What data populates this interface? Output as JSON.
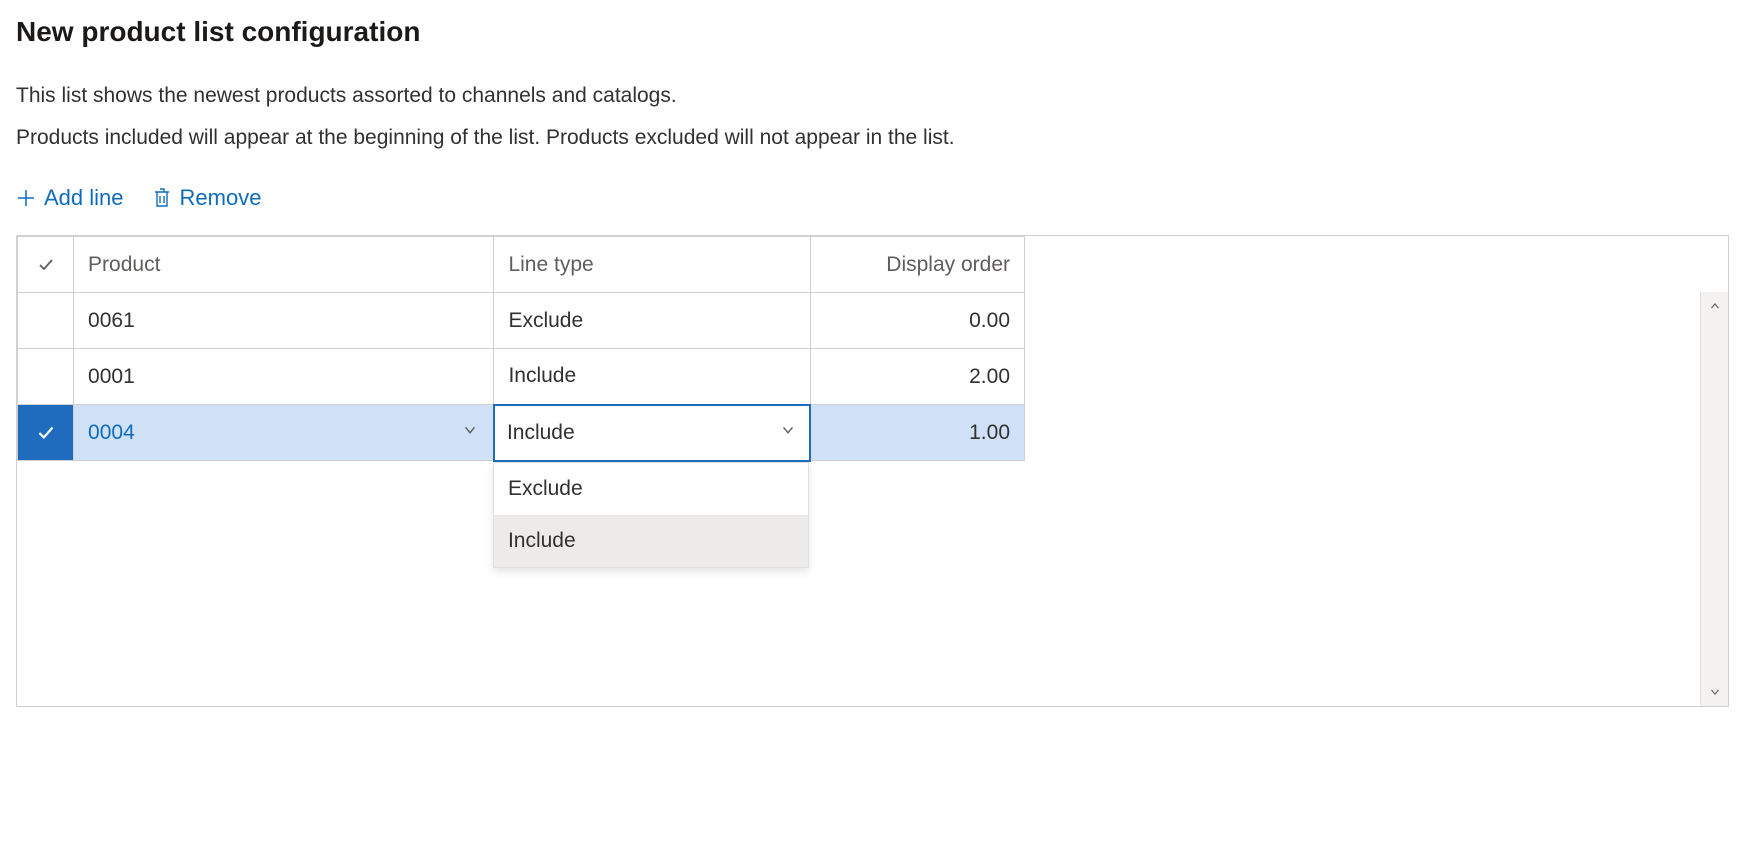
{
  "header": {
    "title": "New product list configuration",
    "description_line1": "This list shows the newest products assorted to channels and catalogs.",
    "description_line2": "Products included will appear at the beginning of the list. Products excluded will not appear in the list."
  },
  "toolbar": {
    "add_line_label": "Add line",
    "remove_label": "Remove"
  },
  "grid": {
    "columns": {
      "product": "Product",
      "line_type": "Line type",
      "display_order": "Display order"
    },
    "rows": [
      {
        "selected": false,
        "product": "0061",
        "line_type": "Exclude",
        "display_order": "0.00"
      },
      {
        "selected": false,
        "product": "0001",
        "line_type": "Include",
        "display_order": "2.00"
      },
      {
        "selected": true,
        "product": "0004",
        "line_type": "Include",
        "display_order": "1.00"
      }
    ],
    "dropdown_options": [
      "Exclude",
      "Include"
    ],
    "dropdown_selected": "Include"
  }
}
